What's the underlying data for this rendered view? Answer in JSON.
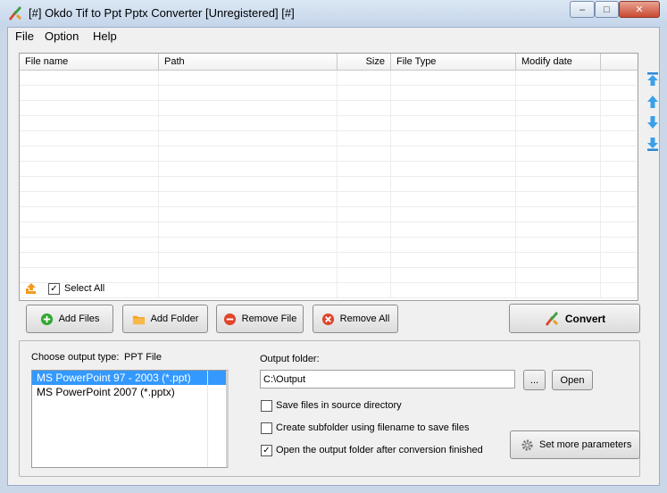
{
  "window": {
    "title": "[#] Okdo Tif to Ppt Pptx Converter [Unregistered] [#]",
    "controls": {
      "minimize": "–",
      "maximize": "□",
      "close": "✕"
    }
  },
  "menu": [
    {
      "label": "File"
    },
    {
      "label": "Option"
    },
    {
      "label": "Help"
    }
  ],
  "file_list": {
    "columns": [
      "File name",
      "Path",
      "Size",
      "File Type",
      "Modify date"
    ],
    "rows": []
  },
  "side_buttons": [
    "move-top-icon",
    "move-up-icon",
    "move-down-icon",
    "move-bottom-icon"
  ],
  "select_all": {
    "label": "Select All",
    "checked": true
  },
  "buttons": {
    "add_files": "Add Files",
    "add_folder": "Add Folder",
    "remove_file": "Remove File",
    "remove_all": "Remove All",
    "convert": "Convert",
    "browse": "...",
    "open": "Open",
    "set_more": "Set more parameters"
  },
  "output": {
    "type_label": "Choose output type:",
    "type_value": "PPT File",
    "types": [
      {
        "label": "MS PowerPoint 97 - 2003 (*.ppt)",
        "selected": true
      },
      {
        "label": "MS PowerPoint 2007 (*.pptx)",
        "selected": false
      }
    ],
    "folder_label": "Output folder:",
    "folder_value": "C:\\Output"
  },
  "options": [
    {
      "label": "Save files in source directory",
      "checked": false
    },
    {
      "label": "Create subfolder using filename to save files",
      "checked": false
    },
    {
      "label": "Open the output folder after conversion finished",
      "checked": true
    }
  ],
  "colors": {
    "accent": "#3399ff",
    "title_bg": "#c9d7e8",
    "close": "#c94a31"
  }
}
